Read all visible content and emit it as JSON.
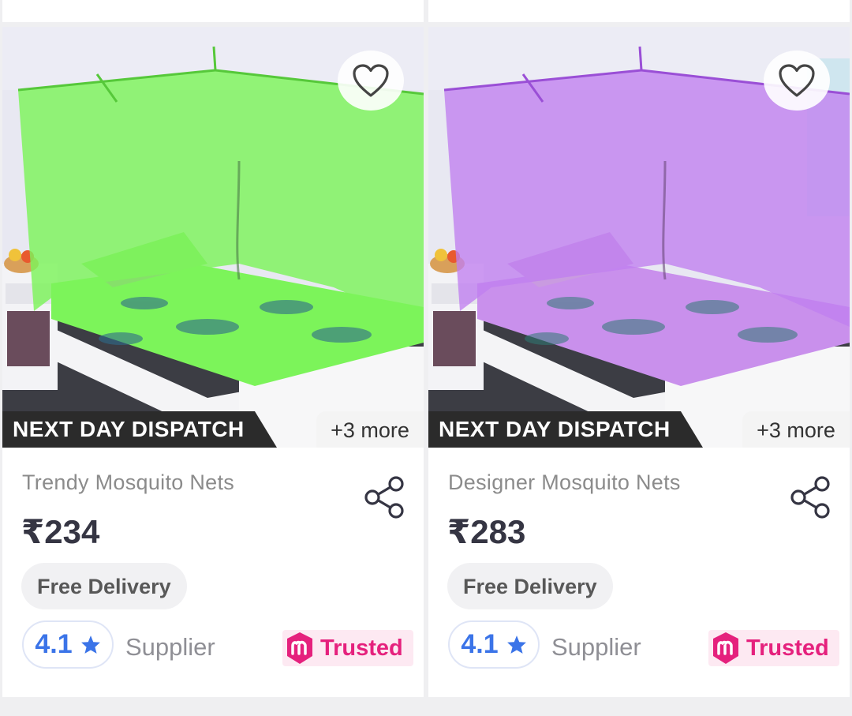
{
  "products": [
    {
      "title": "Trendy Mosquito Nets",
      "price": "₹234",
      "dispatch_badge": "NEXT DAY DISPATCH",
      "more_options": "+3 more",
      "delivery": "Free Delivery",
      "rating": "4.1",
      "supplier_label": "Supplier",
      "trusted_label": "Trusted",
      "net_color": "#7cf45a",
      "image": "green-mosquito-net-bed-photo"
    },
    {
      "title": "Designer Mosquito Nets",
      "price": "₹283",
      "dispatch_badge": "NEXT DAY DISPATCH",
      "more_options": "+3 more",
      "delivery": "Free Delivery",
      "rating": "4.1",
      "supplier_label": "Supplier",
      "trusted_label": "Trusted",
      "net_color": "#c07ff0",
      "image": "purple-mosquito-net-bed-photo"
    }
  ],
  "icons": {
    "wishlist": "heart-outline-icon",
    "share": "share-icon",
    "rating_star": "star-icon",
    "trusted_badge": "meesho-m-icon"
  },
  "colors": {
    "rating_blue": "#3b74e8",
    "trusted_pink": "#e5217d",
    "dispatch_bg": "#2b2b2b"
  }
}
